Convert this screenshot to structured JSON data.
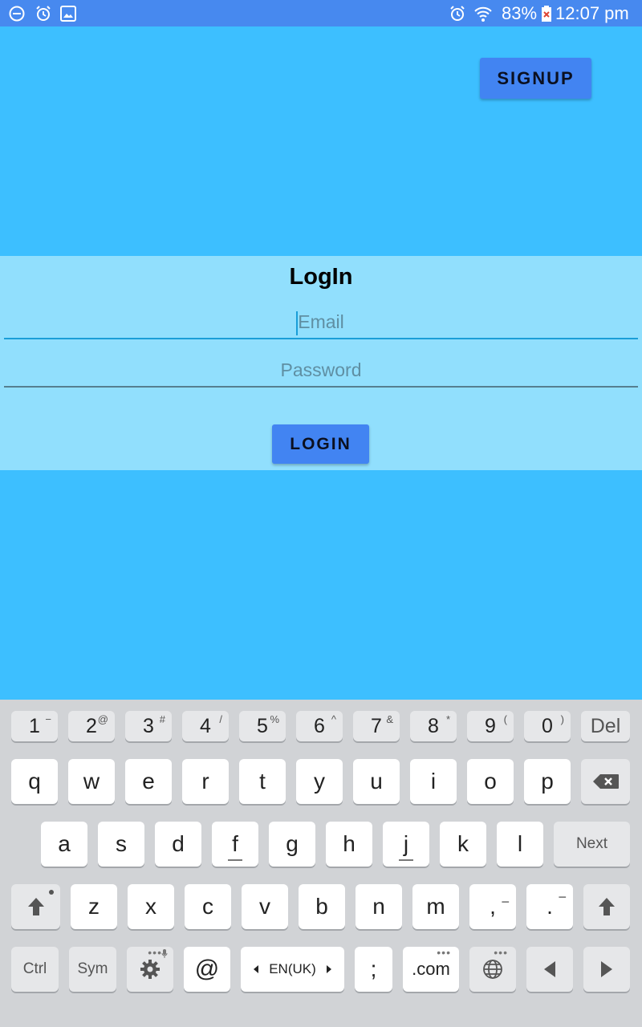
{
  "status_bar": {
    "battery": "83%",
    "time": "12:07 pm"
  },
  "header": {
    "signup_label": "SIGNUP"
  },
  "login": {
    "title": "LogIn",
    "email_placeholder": "Email",
    "password_placeholder": "Password",
    "login_label": "LOGIN"
  },
  "keyboard": {
    "numbers": [
      {
        "label": "1",
        "sup": "−"
      },
      {
        "label": "2",
        "sup": "@"
      },
      {
        "label": "3",
        "sup": "#"
      },
      {
        "label": "4",
        "sup": "/"
      },
      {
        "label": "5",
        "sup": "%"
      },
      {
        "label": "6",
        "sup": "^"
      },
      {
        "label": "7",
        "sup": "&"
      },
      {
        "label": "8",
        "sup": "*"
      },
      {
        "label": "9",
        "sup": "("
      },
      {
        "label": "0",
        "sup": ")"
      }
    ],
    "del": "Del",
    "row1": [
      "q",
      "w",
      "e",
      "r",
      "t",
      "y",
      "u",
      "i",
      "o",
      "p"
    ],
    "row2": [
      "a",
      "s",
      "d",
      "f",
      "g",
      "h",
      "j",
      "k",
      "l"
    ],
    "next": "Next",
    "row3": [
      "z",
      "x",
      "c",
      "v",
      "b",
      "n",
      "m"
    ],
    "comma": ",",
    "comma_sup": "−",
    "period": ".",
    "period_sup": "−",
    "ctrl": "Ctrl",
    "sym": "Sym",
    "at": "@",
    "language": "EN(UK)",
    "semicolon": ";",
    "dotcom": ".com"
  },
  "colors": {
    "background": "#3dbfff",
    "panel": "#91dffd",
    "button": "#4284f2",
    "status_bar": "#4789ef"
  }
}
